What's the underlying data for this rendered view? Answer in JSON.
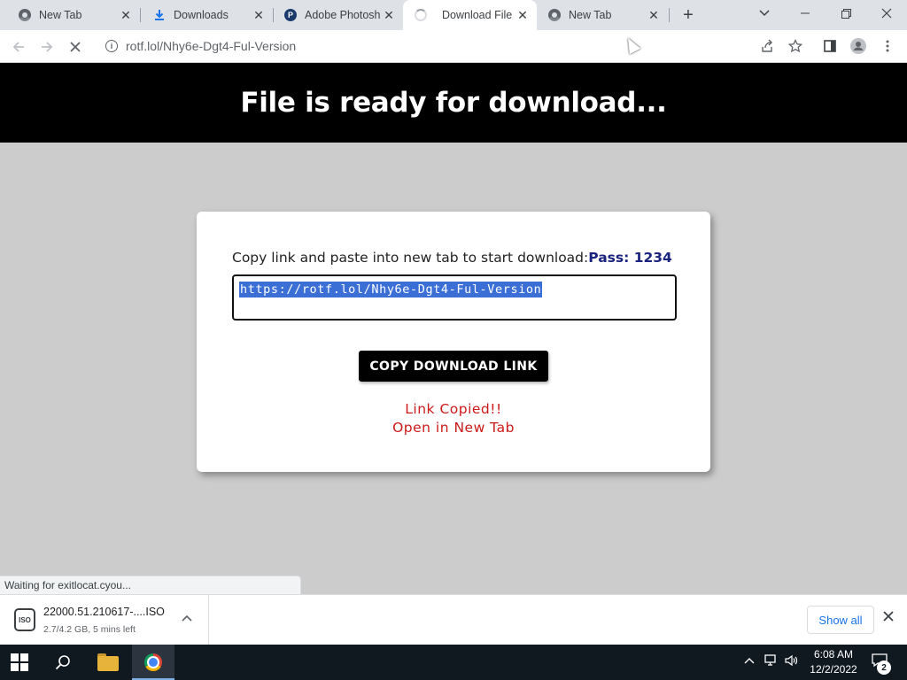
{
  "browser": {
    "tabs": [
      {
        "label": "New Tab",
        "icon": "chrome-icon"
      },
      {
        "label": "Downloads",
        "icon": "download-icon"
      },
      {
        "label": "Adobe Photosh",
        "icon": "photoshop-icon"
      },
      {
        "label": "Download File",
        "icon": "loading-spinner-icon",
        "active": true
      },
      {
        "label": "New Tab",
        "icon": "chrome-icon"
      }
    ],
    "url": "rotf.lol/Nhy6e-Dgt4-Ful-Version",
    "status_text": "Waiting for exitlocat.cyou..."
  },
  "page": {
    "header_title": "File is ready for download...",
    "instruction_text": "Copy link and paste into new tab to start download:",
    "pass_text": "Pass: 1234",
    "download_link": "https://rotf.lol/Nhy6e-Dgt4-Ful-Version",
    "copy_button_label": "COPY DOWNLOAD LINK",
    "copied_message": "Link Copied!!",
    "open_message": "Open in New Tab"
  },
  "download_bar": {
    "file_name": "22000.51.210617-....ISO",
    "progress_text": "2.7/4.2 GB, 5 mins left",
    "file_icon_label": "ISO",
    "show_all_label": "Show all"
  },
  "taskbar": {
    "time": "6:08 AM",
    "date": "12/2/2022",
    "notification_count": "2"
  },
  "colors": {
    "header_bg": "#000000",
    "page_bg": "#cccccc",
    "pass_color": "#1a237e",
    "copied_color": "#cc1a1a",
    "selection_color": "#3b6fd6"
  }
}
